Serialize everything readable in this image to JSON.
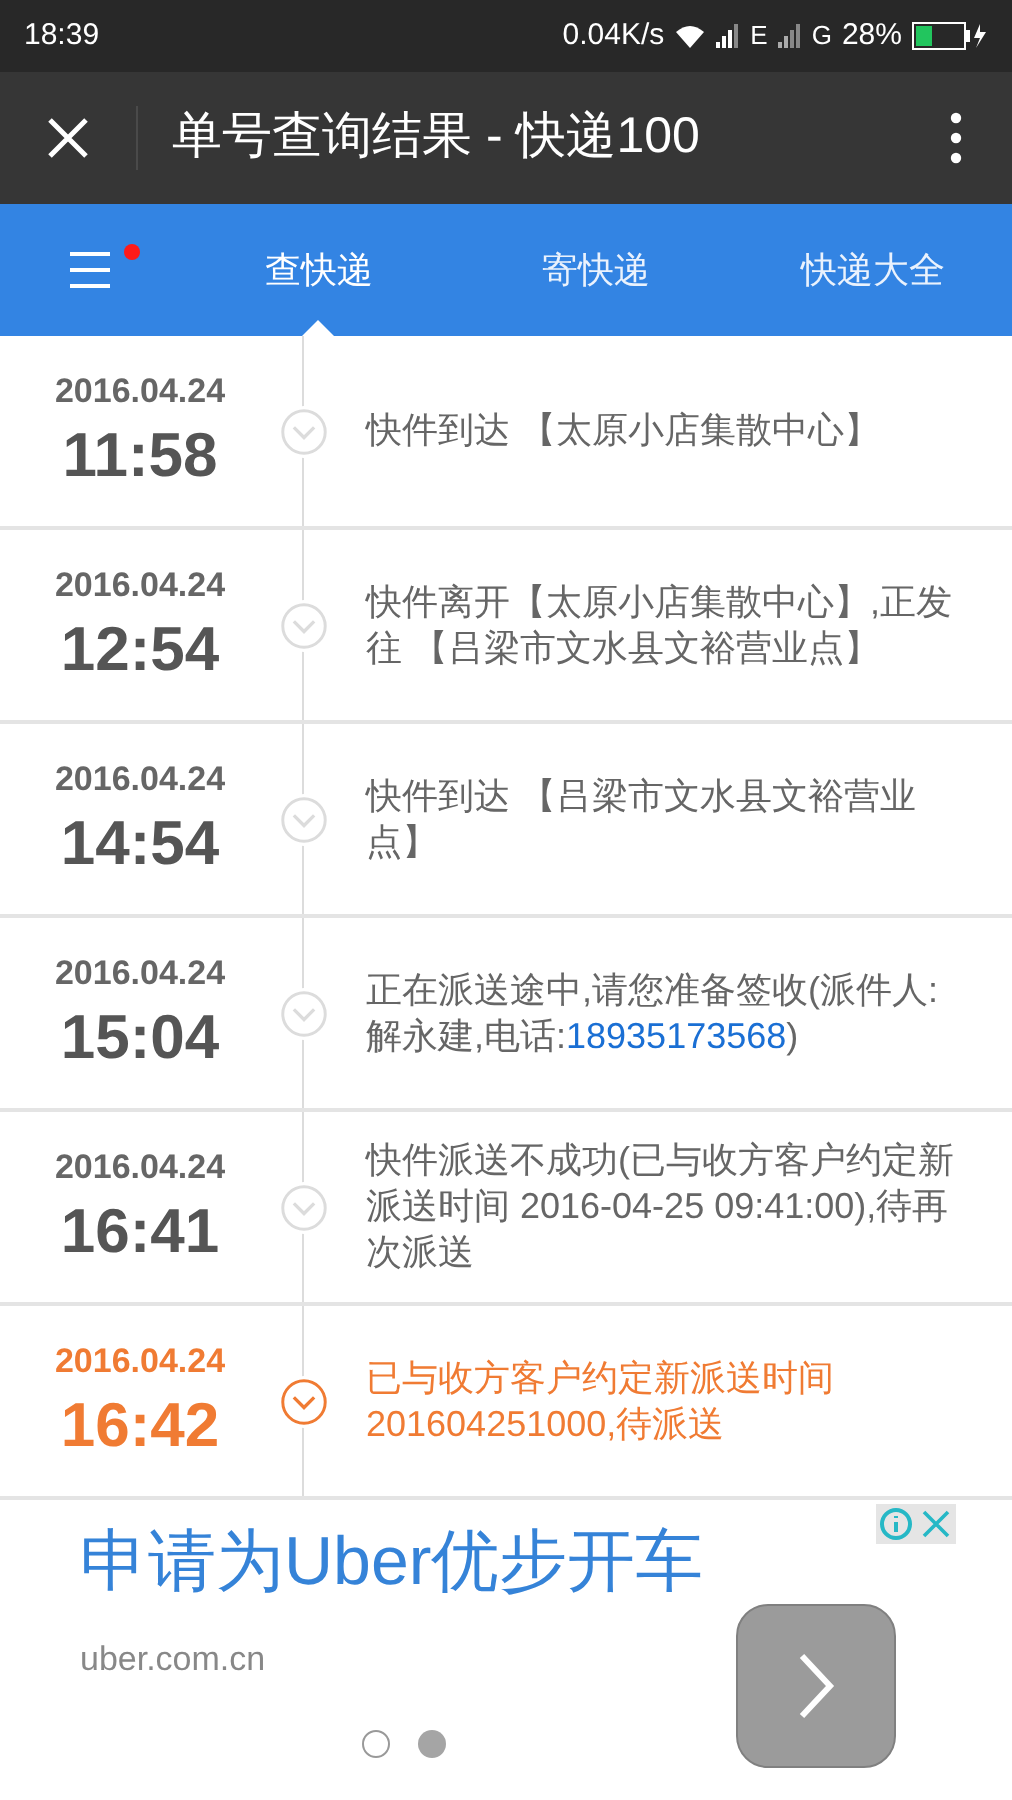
{
  "status_bar": {
    "time": "18:39",
    "speed": "0.04K/s",
    "network_1": "E",
    "network_2": "G",
    "battery": "28%"
  },
  "title_bar": {
    "title": "单号查询结果 - 快递100"
  },
  "nav": {
    "menu_badge": true,
    "tabs": [
      {
        "label": "查快递",
        "selected": true
      },
      {
        "label": "寄快递",
        "selected": false
      },
      {
        "label": "快递大全",
        "selected": false
      }
    ]
  },
  "events": [
    {
      "date": "2016.04.24",
      "time": "11:58",
      "current": false,
      "segments": [
        {
          "kind": "plain",
          "text": "快件到达 【太原小店集散中心】"
        }
      ]
    },
    {
      "date": "2016.04.24",
      "time": "12:54",
      "current": false,
      "segments": [
        {
          "kind": "plain",
          "text": "快件离开【太原小店集散中心】,正发往 【吕梁市文水县文裕营业点】"
        }
      ]
    },
    {
      "date": "2016.04.24",
      "time": "14:54",
      "current": false,
      "segments": [
        {
          "kind": "plain",
          "text": "快件到达 【吕梁市文水县文裕营业点】"
        }
      ]
    },
    {
      "date": "2016.04.24",
      "time": "15:04",
      "current": false,
      "segments": [
        {
          "kind": "plain",
          "text": "正在派送途中,请您准备签收(派件人:解永建,电话:"
        },
        {
          "kind": "phone",
          "text": "18935173568"
        },
        {
          "kind": "plain",
          "text": ")"
        }
      ]
    },
    {
      "date": "2016.04.24",
      "time": "16:41",
      "current": false,
      "segments": [
        {
          "kind": "plain",
          "text": "快件派送不成功(已与收方客户约定新派送时间 2016-04-25 09:41:00),待再次派送"
        }
      ]
    },
    {
      "date": "2016.04.24",
      "time": "16:42",
      "current": true,
      "segments": [
        {
          "kind": "plain",
          "text": "已与收方客户约定新派送时间201604251000,待派送"
        }
      ]
    }
  ],
  "ad": {
    "headline": "申请为Uber优步开车",
    "domain": "uber.com.cn",
    "dots": [
      {
        "selected": false
      },
      {
        "selected": true
      }
    ]
  }
}
